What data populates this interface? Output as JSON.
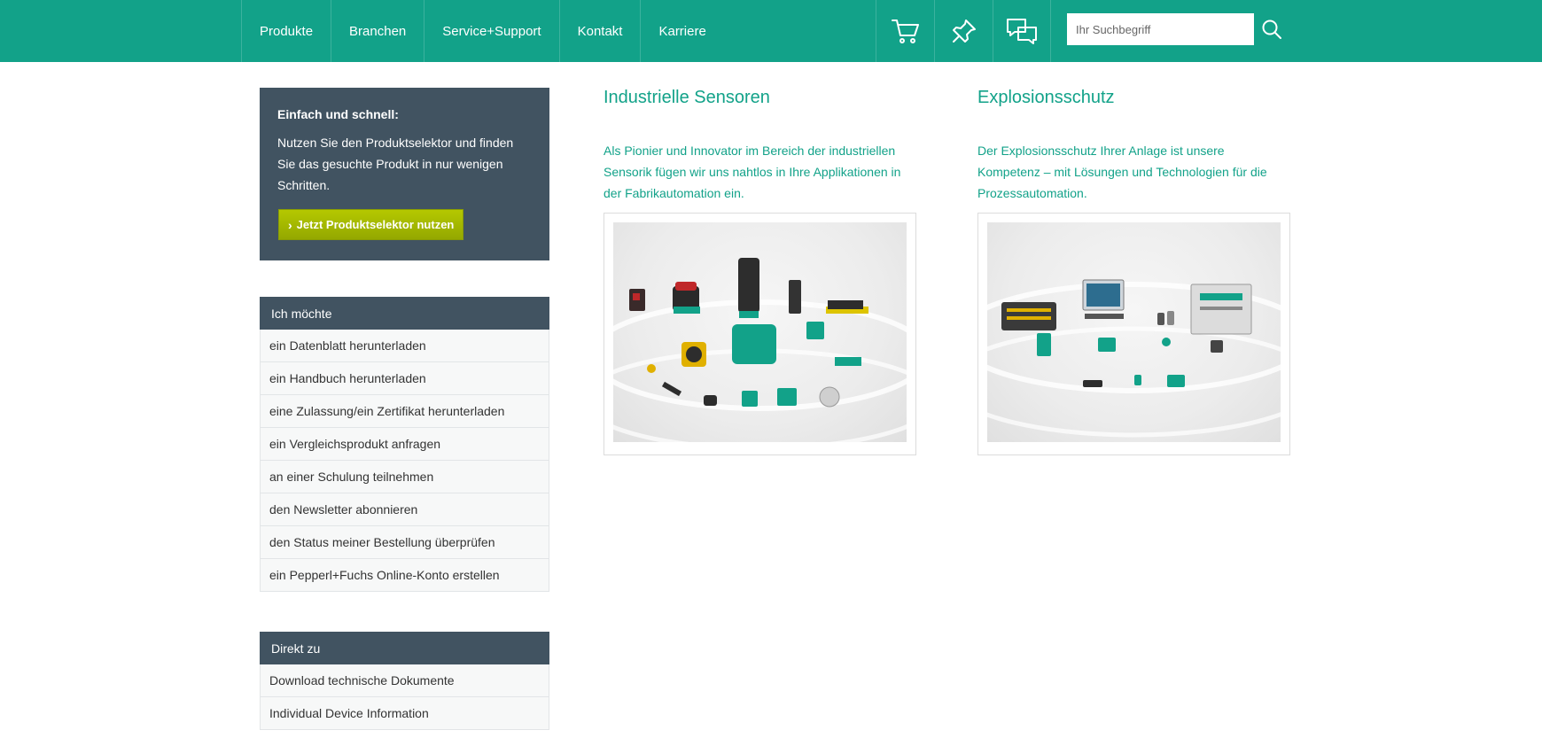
{
  "nav": {
    "items": [
      "Produkte",
      "Branchen",
      "Service+Support",
      "Kontakt",
      "Karriere"
    ]
  },
  "tools": {
    "icons": [
      "cart-icon",
      "pin-icon",
      "chat-icon"
    ]
  },
  "search": {
    "placeholder": "Ihr Suchbegriff"
  },
  "promo": {
    "title": "Einfach und schnell:",
    "text": "Nutzen Sie den Produktselektor und finden Sie das gesuchte Produkt in nur wenigen Schritten.",
    "button_label": "Jetzt Produktselektor nutzen"
  },
  "want": {
    "title": "Ich möchte",
    "items": [
      "ein Datenblatt herunterladen",
      "ein Handbuch herunterladen",
      "eine Zulassung/ein Zertifikat herunterladen",
      "ein Vergleichsprodukt anfragen",
      "an einer Schulung teilnehmen",
      "den Newsletter abonnieren",
      "den Status meiner Bestellung überprüfen",
      "ein Pepperl+Fuchs Online-Konto erstellen"
    ]
  },
  "direct": {
    "title": "Direkt zu",
    "items": [
      "Download technische Dokumente",
      "Individual Device Information"
    ]
  },
  "columns": [
    {
      "title": "Industrielle Sensoren",
      "text": "Als Pionier und Innovator im Bereich der industriellen Sensorik fügen wir uns nahtlos in Ihre Applikationen in der Fabrikautomation ein."
    },
    {
      "title": "Explosionsschutz",
      "text": "Der Explosionsschutz Ihrer Anlage ist unsere Kompetenz – mit Lösungen und Technologien für die Prozessautomation."
    }
  ],
  "colors": {
    "brand": "#12a289",
    "panel": "#415361",
    "button": "#a3b800"
  }
}
